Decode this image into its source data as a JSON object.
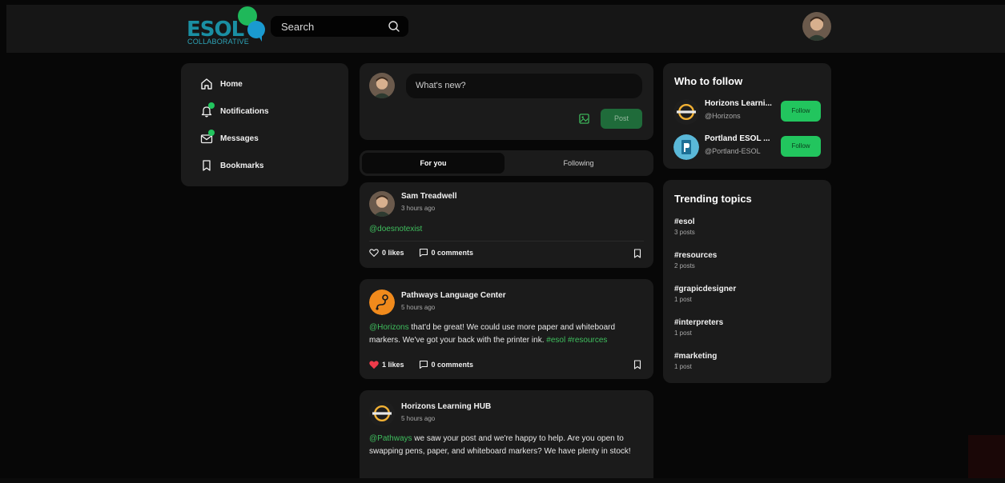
{
  "brand": {
    "word": "ESOL",
    "sub": "COLLABORATIVE",
    "colors": {
      "teal": "#1a8fa3",
      "green": "#1fb85a",
      "blue": "#1a9ad0"
    }
  },
  "search": {
    "label": "Search",
    "icon": "search-icon"
  },
  "nav": {
    "items": [
      {
        "label": "Home",
        "icon": "home-icon"
      },
      {
        "label": "Notifications",
        "icon": "bell-icon"
      },
      {
        "label": "Messages",
        "icon": "mail-icon"
      },
      {
        "label": "Bookmarks",
        "icon": "bookmark-icon"
      }
    ]
  },
  "composer": {
    "placeholder": "What's new?",
    "post_label": "Post",
    "icon": "image-icon"
  },
  "tabs": {
    "active": "For you",
    "inactive": "Following"
  },
  "posts": [
    {
      "author": "Sam Treadwell",
      "time": "3 hours ago",
      "body_mention": "@doesnotexist",
      "likes": "0 likes",
      "comments": "0 comments",
      "liked": false
    },
    {
      "author": "Pathways Language Center",
      "time": "5 hours ago",
      "body_mention": "@Horizons",
      "body_text": " that'd be great! We could use more paper and whiteboard markers. We've got your back with the printer ink. ",
      "body_tags": "#esol #resources",
      "likes": "1 likes",
      "comments": "0 comments",
      "liked": true
    },
    {
      "author": "Horizons Learning HUB",
      "time": "5 hours ago",
      "body_mention": "@Pathways",
      "body_text": " we saw your post and we're happy to help. Are you open to swapping pens, paper, and whiteboard markers? We have plenty in stock!"
    }
  ],
  "follow": {
    "title": "Who to follow",
    "items": [
      {
        "name": "Horizons Learni...",
        "handle": "@Horizons",
        "button": "Follow"
      },
      {
        "name": "Portland ESOL ...",
        "handle": "@Portland-ESOL",
        "button": "Follow"
      }
    ]
  },
  "trending": {
    "title": "Trending topics",
    "items": [
      {
        "tag": "#esol",
        "count": "3 posts"
      },
      {
        "tag": "#resources",
        "count": "2 posts"
      },
      {
        "tag": "#grapicdesigner",
        "count": "1 post"
      },
      {
        "tag": "#interpreters",
        "count": "1 post"
      },
      {
        "tag": "#marketing",
        "count": "1 post"
      }
    ]
  },
  "accent": "#22c55e"
}
